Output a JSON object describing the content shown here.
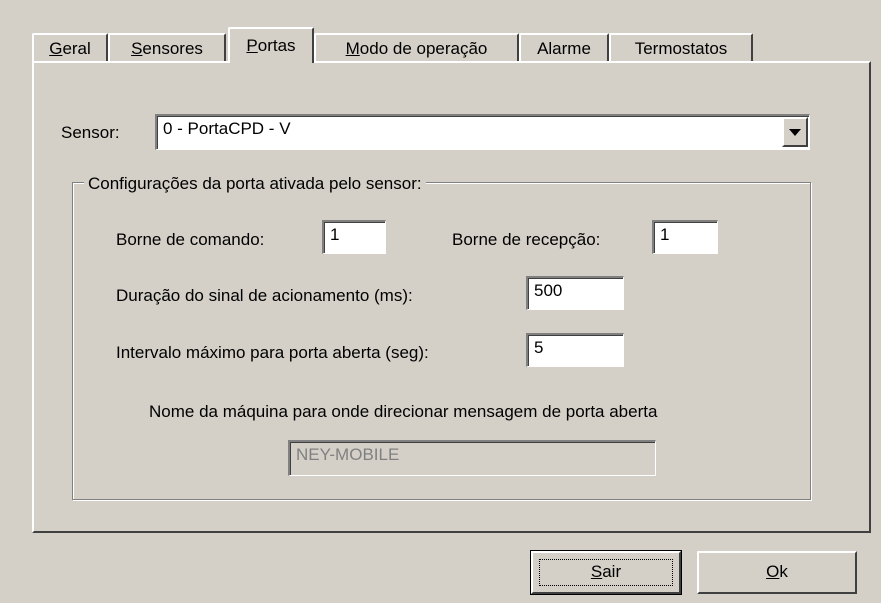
{
  "tabs": [
    {
      "pre": "",
      "key": "G",
      "post": "eral"
    },
    {
      "pre": "",
      "key": "S",
      "post": "ensores"
    },
    {
      "pre": "",
      "key": "P",
      "post": "ortas"
    },
    {
      "pre": "",
      "key": "M",
      "post": "odo de operação"
    },
    {
      "pre": "Alarme",
      "key": "",
      "post": ""
    },
    {
      "pre": "Termostatos",
      "key": "",
      "post": ""
    }
  ],
  "sensor": {
    "label": "Sensor:",
    "value": "0 - PortaCPD - V"
  },
  "group": {
    "title": "Configurações da porta ativada pelo sensor:",
    "borne_comando_label": "Borne de comando:",
    "borne_comando_value": "1",
    "borne_recepcao_label": "Borne de recepção:",
    "borne_recepcao_value": "1",
    "duracao_label": "Duração do sinal de acionamento (ms):",
    "duracao_value": "500",
    "intervalo_label": "Intervalo máximo para porta aberta (seg):",
    "intervalo_value": "5",
    "maquina_label": "Nome da máquina para onde direcionar mensagem de porta aberta",
    "maquina_value": "NEY-MOBILE"
  },
  "buttons": {
    "sair_key": "S",
    "sair_rest": "air",
    "ok_key": "O",
    "ok_rest": "k"
  }
}
